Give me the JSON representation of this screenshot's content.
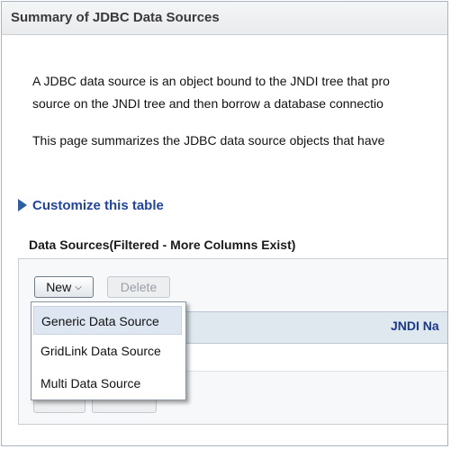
{
  "header": {
    "title": "Summary of JDBC Data Sources"
  },
  "description": {
    "line1": "A JDBC data source is an object bound to the JNDI tree that pro",
    "line2": "source on the JNDI tree and then borrow a database connectio",
    "line3": "This page summarizes the JDBC data source objects that have"
  },
  "customize": {
    "label": "Customize this table"
  },
  "table": {
    "title": "Data Sources(Filtered - More Columns Exist)",
    "new_label": "New",
    "delete_label": "Delete",
    "columns": [
      "JNDI Na"
    ]
  },
  "new_menu": {
    "items": [
      "Generic Data Source",
      "GridLink Data Source",
      "Multi Data Source"
    ],
    "highlighted": "Generic Data Source"
  }
}
